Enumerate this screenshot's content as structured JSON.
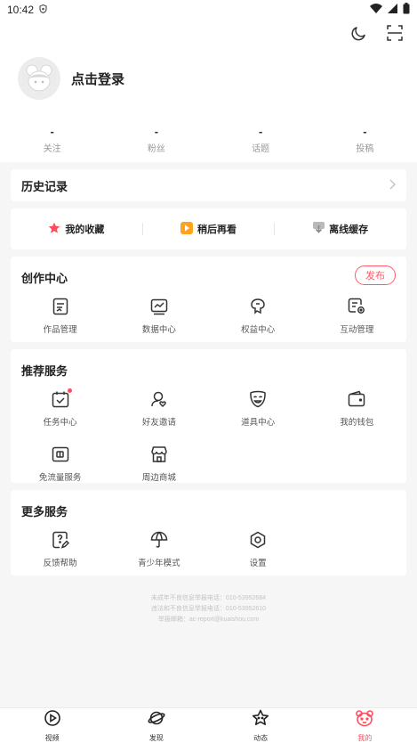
{
  "status_bar": {
    "time": "10:42"
  },
  "profile": {
    "login_text": "点击登录"
  },
  "stats": [
    {
      "value": "-",
      "label": "关注"
    },
    {
      "value": "-",
      "label": "粉丝"
    },
    {
      "value": "-",
      "label": "话题"
    },
    {
      "value": "-",
      "label": "投稿"
    }
  ],
  "history": {
    "title": "历史记录"
  },
  "quick_actions": [
    {
      "label": "我的收藏"
    },
    {
      "label": "稍后再看"
    },
    {
      "label": "离线缓存"
    }
  ],
  "creation": {
    "title": "创作中心",
    "publish_label": "发布",
    "items": [
      {
        "label": "作品管理"
      },
      {
        "label": "数据中心"
      },
      {
        "label": "权益中心"
      },
      {
        "label": "互动管理"
      }
    ]
  },
  "recommend": {
    "title": "推荐服务",
    "items": [
      {
        "label": "任务中心"
      },
      {
        "label": "好友邀请"
      },
      {
        "label": "道具中心"
      },
      {
        "label": "我的钱包"
      },
      {
        "label": "免流量服务"
      },
      {
        "label": "周边商城"
      }
    ]
  },
  "more": {
    "title": "更多服务",
    "items": [
      {
        "label": "反馈帮助"
      },
      {
        "label": "青少年模式"
      },
      {
        "label": "设置"
      }
    ]
  },
  "footer": {
    "lines": [
      "未成年不良信息举报电话：010-53952684",
      "违法和不良信息举报电话：010-53952610",
      "举报邮箱：ac-report@kuaishou.com"
    ]
  },
  "tabs": [
    {
      "label": "视频",
      "active": false
    },
    {
      "label": "发现",
      "active": false
    },
    {
      "label": "动态",
      "active": false
    },
    {
      "label": "我的",
      "active": true
    }
  ],
  "colors": {
    "accent": "#ff4d5e",
    "publish": "#ff5a6a",
    "later": "#ffa31a",
    "background": "#f6f6f6"
  }
}
